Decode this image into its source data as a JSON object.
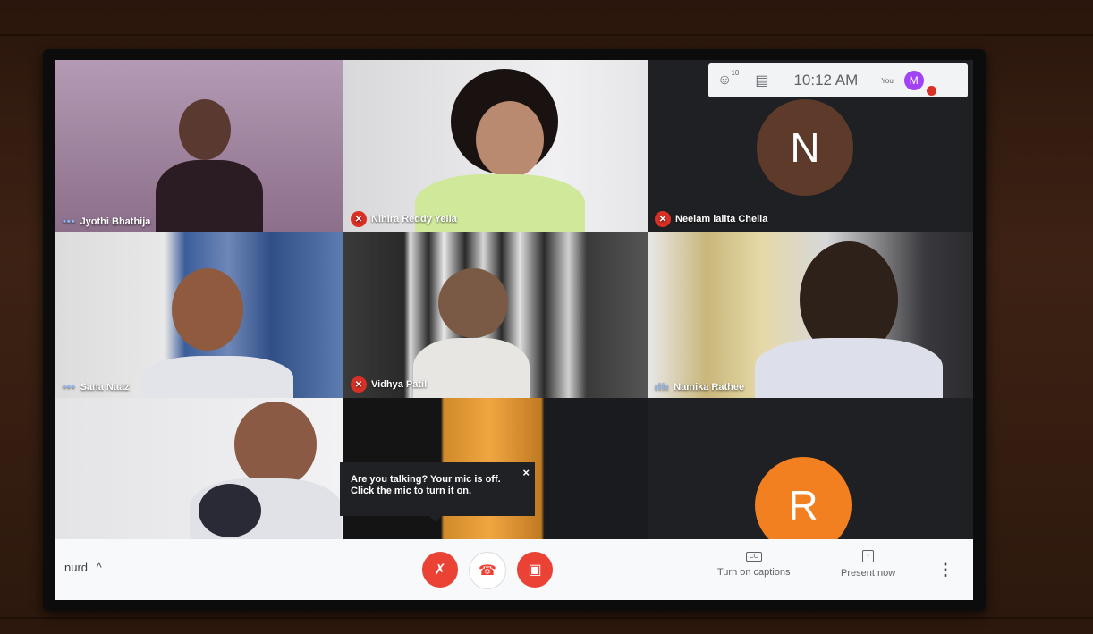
{
  "topbar": {
    "participants_icon": "people-icon",
    "participants_count": "10",
    "chat_icon": "chat-icon",
    "time": "10:12 AM",
    "you_label": "You",
    "you_initial": "M"
  },
  "participants": [
    {
      "name": "Jyothi Bhathija",
      "status": "speaking-dots"
    },
    {
      "name": "Nihira Reddy Yella",
      "status": "muted"
    },
    {
      "name": "Neelam lalita Chella",
      "status": "muted",
      "initial": "N",
      "avatar_color": "#5d3a2a"
    },
    {
      "name": "Sana Naaz",
      "status": "speaking-dots"
    },
    {
      "name": "Vidhya Patil",
      "status": "muted"
    },
    {
      "name": "Namika Rathee",
      "status": "speaking-bars"
    },
    {
      "name": "",
      "status": "none"
    },
    {
      "name": "",
      "status": "none"
    },
    {
      "name": "",
      "status": "none",
      "initial": "R",
      "avatar_color": "#f28020"
    }
  ],
  "tooltip": {
    "text": "Are you talking? Your mic is off. Click the mic to turn it on.",
    "close_glyph": "×"
  },
  "bottombar": {
    "meeting_code": "nurd",
    "chevron": "^",
    "mic_icon": "mic-off-icon",
    "hangup_icon": "hangup-icon",
    "camera_icon": "camera-off-icon",
    "captions_glyph": "CC",
    "captions_label": "Turn on captions",
    "present_glyph": "↑",
    "present_label": "Present now",
    "more_glyph": "⋮"
  },
  "colors": {
    "mute_red": "#d93025",
    "control_red": "#ea4335",
    "you_avatar": "#a142f4"
  }
}
